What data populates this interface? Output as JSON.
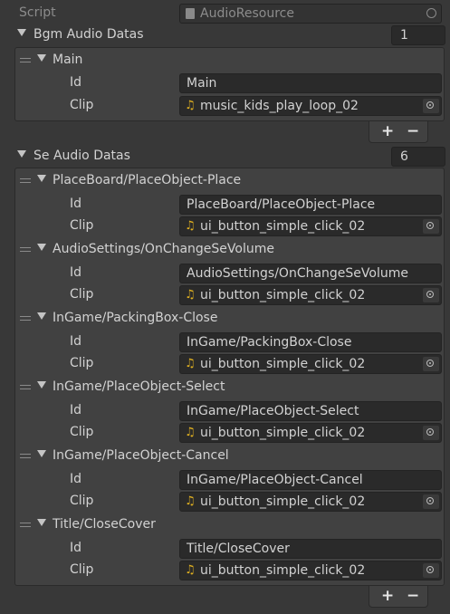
{
  "script": {
    "label": "Script",
    "value": "AudioResource"
  },
  "bgm": {
    "header": "Bgm Audio Datas",
    "count": "1",
    "items": [
      {
        "name": "Main",
        "id_label": "Id",
        "id": "Main",
        "clip_label": "Clip",
        "clip": "music_kids_play_loop_02"
      }
    ]
  },
  "se": {
    "header": "Se Audio Datas",
    "count": "6",
    "items": [
      {
        "name": "PlaceBoard/PlaceObject-Place",
        "id_label": "Id",
        "id": "PlaceBoard/PlaceObject-Place",
        "clip_label": "Clip",
        "clip": "ui_button_simple_click_02"
      },
      {
        "name": "AudioSettings/OnChangeSeVolume",
        "id_label": "Id",
        "id": "AudioSettings/OnChangeSeVolume",
        "clip_label": "Clip",
        "clip": "ui_button_simple_click_02"
      },
      {
        "name": "InGame/PackingBox-Close",
        "id_label": "Id",
        "id": "InGame/PackingBox-Close",
        "clip_label": "Clip",
        "clip": "ui_button_simple_click_02"
      },
      {
        "name": "InGame/PlaceObject-Select",
        "id_label": "Id",
        "id": "InGame/PlaceObject-Select",
        "clip_label": "Clip",
        "clip": "ui_button_simple_click_02"
      },
      {
        "name": "InGame/PlaceObject-Cancel",
        "id_label": "Id",
        "id": "InGame/PlaceObject-Cancel",
        "clip_label": "Clip",
        "clip": "ui_button_simple_click_02"
      },
      {
        "name": "Title/CloseCover",
        "id_label": "Id",
        "id": "Title/CloseCover",
        "clip_label": "Clip",
        "clip": "ui_button_simple_click_02"
      }
    ]
  },
  "buttons": {
    "add": "+",
    "remove": "−"
  },
  "icons": {
    "script": "script-file-icon",
    "clip": "music-note-icon",
    "picker": "object-picker-icon"
  },
  "colors": {
    "background": "#383838",
    "field": "#2a2a2a",
    "note": "#e0b020"
  }
}
